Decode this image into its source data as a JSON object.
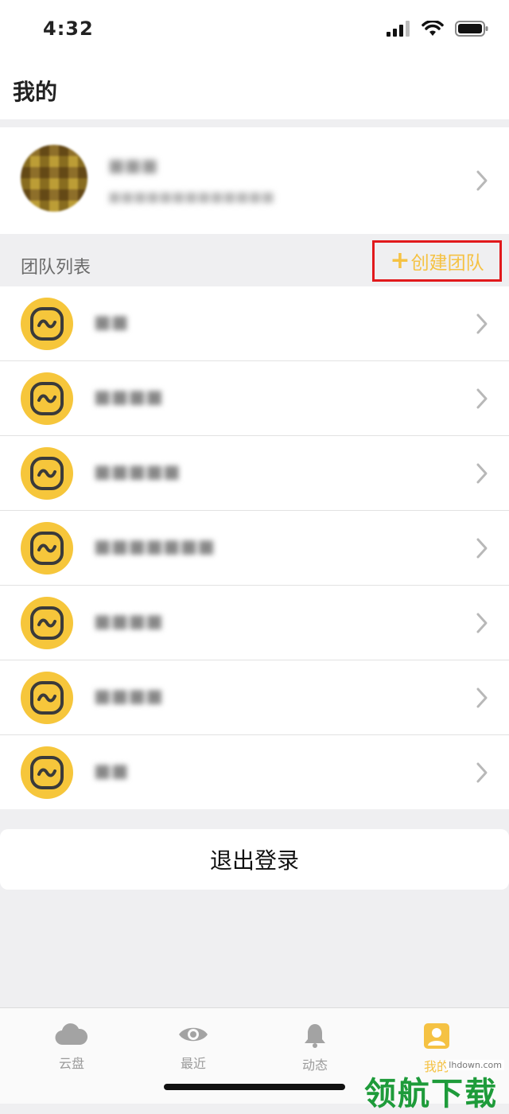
{
  "status_bar": {
    "time": "4:32"
  },
  "header": {
    "title": "我的"
  },
  "profile": {
    "name": "■■■",
    "subtitle": "■■■■■■■■■■■■■"
  },
  "teams": {
    "section_title": "团队列表",
    "create_plus": "+",
    "create_label": "创建团队",
    "items": [
      {
        "name": "■■"
      },
      {
        "name": "■■■■"
      },
      {
        "name": "■■■■■"
      },
      {
        "name": "■■■■■■■"
      },
      {
        "name": "■■■■"
      },
      {
        "name": "■■■■"
      },
      {
        "name": "■■"
      }
    ]
  },
  "logout_label": "退出登录",
  "tabs": [
    {
      "label": "云盘",
      "icon": "cloud-icon"
    },
    {
      "label": "最近",
      "icon": "eye-icon"
    },
    {
      "label": "动态",
      "icon": "bell-icon"
    },
    {
      "label": "我的",
      "icon": "person-icon",
      "active": true
    }
  ],
  "watermark": {
    "url": "lhdown.com",
    "text": "领航下载"
  },
  "colors": {
    "accent": "#f5c243",
    "highlight_box": "#e1191c",
    "team_icon": "#f6c63b",
    "watermark": "#1e9b3a"
  }
}
